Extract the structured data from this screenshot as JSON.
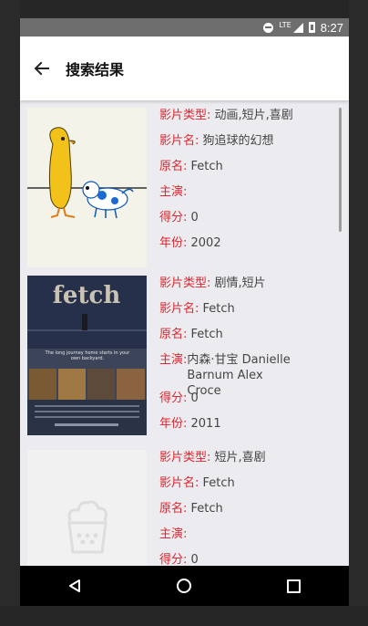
{
  "status_bar": {
    "time": "8:27",
    "network": "LTE"
  },
  "app_bar": {
    "title": "搜索结果",
    "back_icon": "arrow-left-icon"
  },
  "results": [
    {
      "poster": "cartoon-bird-dog",
      "type_label": "影片类型: ",
      "type_value": "动画,短片,喜剧",
      "name_label": "影片名: ",
      "name_value": "狗追球的幻想",
      "original_label": "原名: ",
      "original_value": "Fetch",
      "cast_label": "主演: ",
      "cast_value": "",
      "score_label": "得分: ",
      "score_value": "0",
      "year_label": "年份: ",
      "year_value": "2002"
    },
    {
      "poster": "fetch-movie-poster",
      "poster_title": "fetch",
      "poster_tagline": "The long journey home starts in your own backyard.",
      "type_label": "影片类型: ",
      "type_value": "剧情,短片",
      "name_label": "影片名: ",
      "name_value": "Fetch",
      "original_label": "原名: ",
      "original_value": "Fetch",
      "cast_label": "主演: ",
      "cast_value": "内森·甘宝 Danielle Barnum Alex Croce",
      "score_label": "得分: ",
      "score_value": "0",
      "year_label": "年份: ",
      "year_value": "2011"
    },
    {
      "poster": "popcorn-placeholder",
      "type_label": "影片类型: ",
      "type_value": "短片,喜剧",
      "name_label": "影片名: ",
      "name_value": "Fetch",
      "original_label": "原名: ",
      "original_value": "Fetch",
      "cast_label": "主演: ",
      "cast_value": "",
      "score_label": "得分: ",
      "score_value": "0"
    }
  ],
  "nav_bar": {
    "back": "triangle-back-icon",
    "home": "circle-home-icon",
    "recents": "square-recents-icon"
  },
  "colors": {
    "label_red": "#e0252f",
    "value_gray": "#444444",
    "background": "#ececf0"
  }
}
